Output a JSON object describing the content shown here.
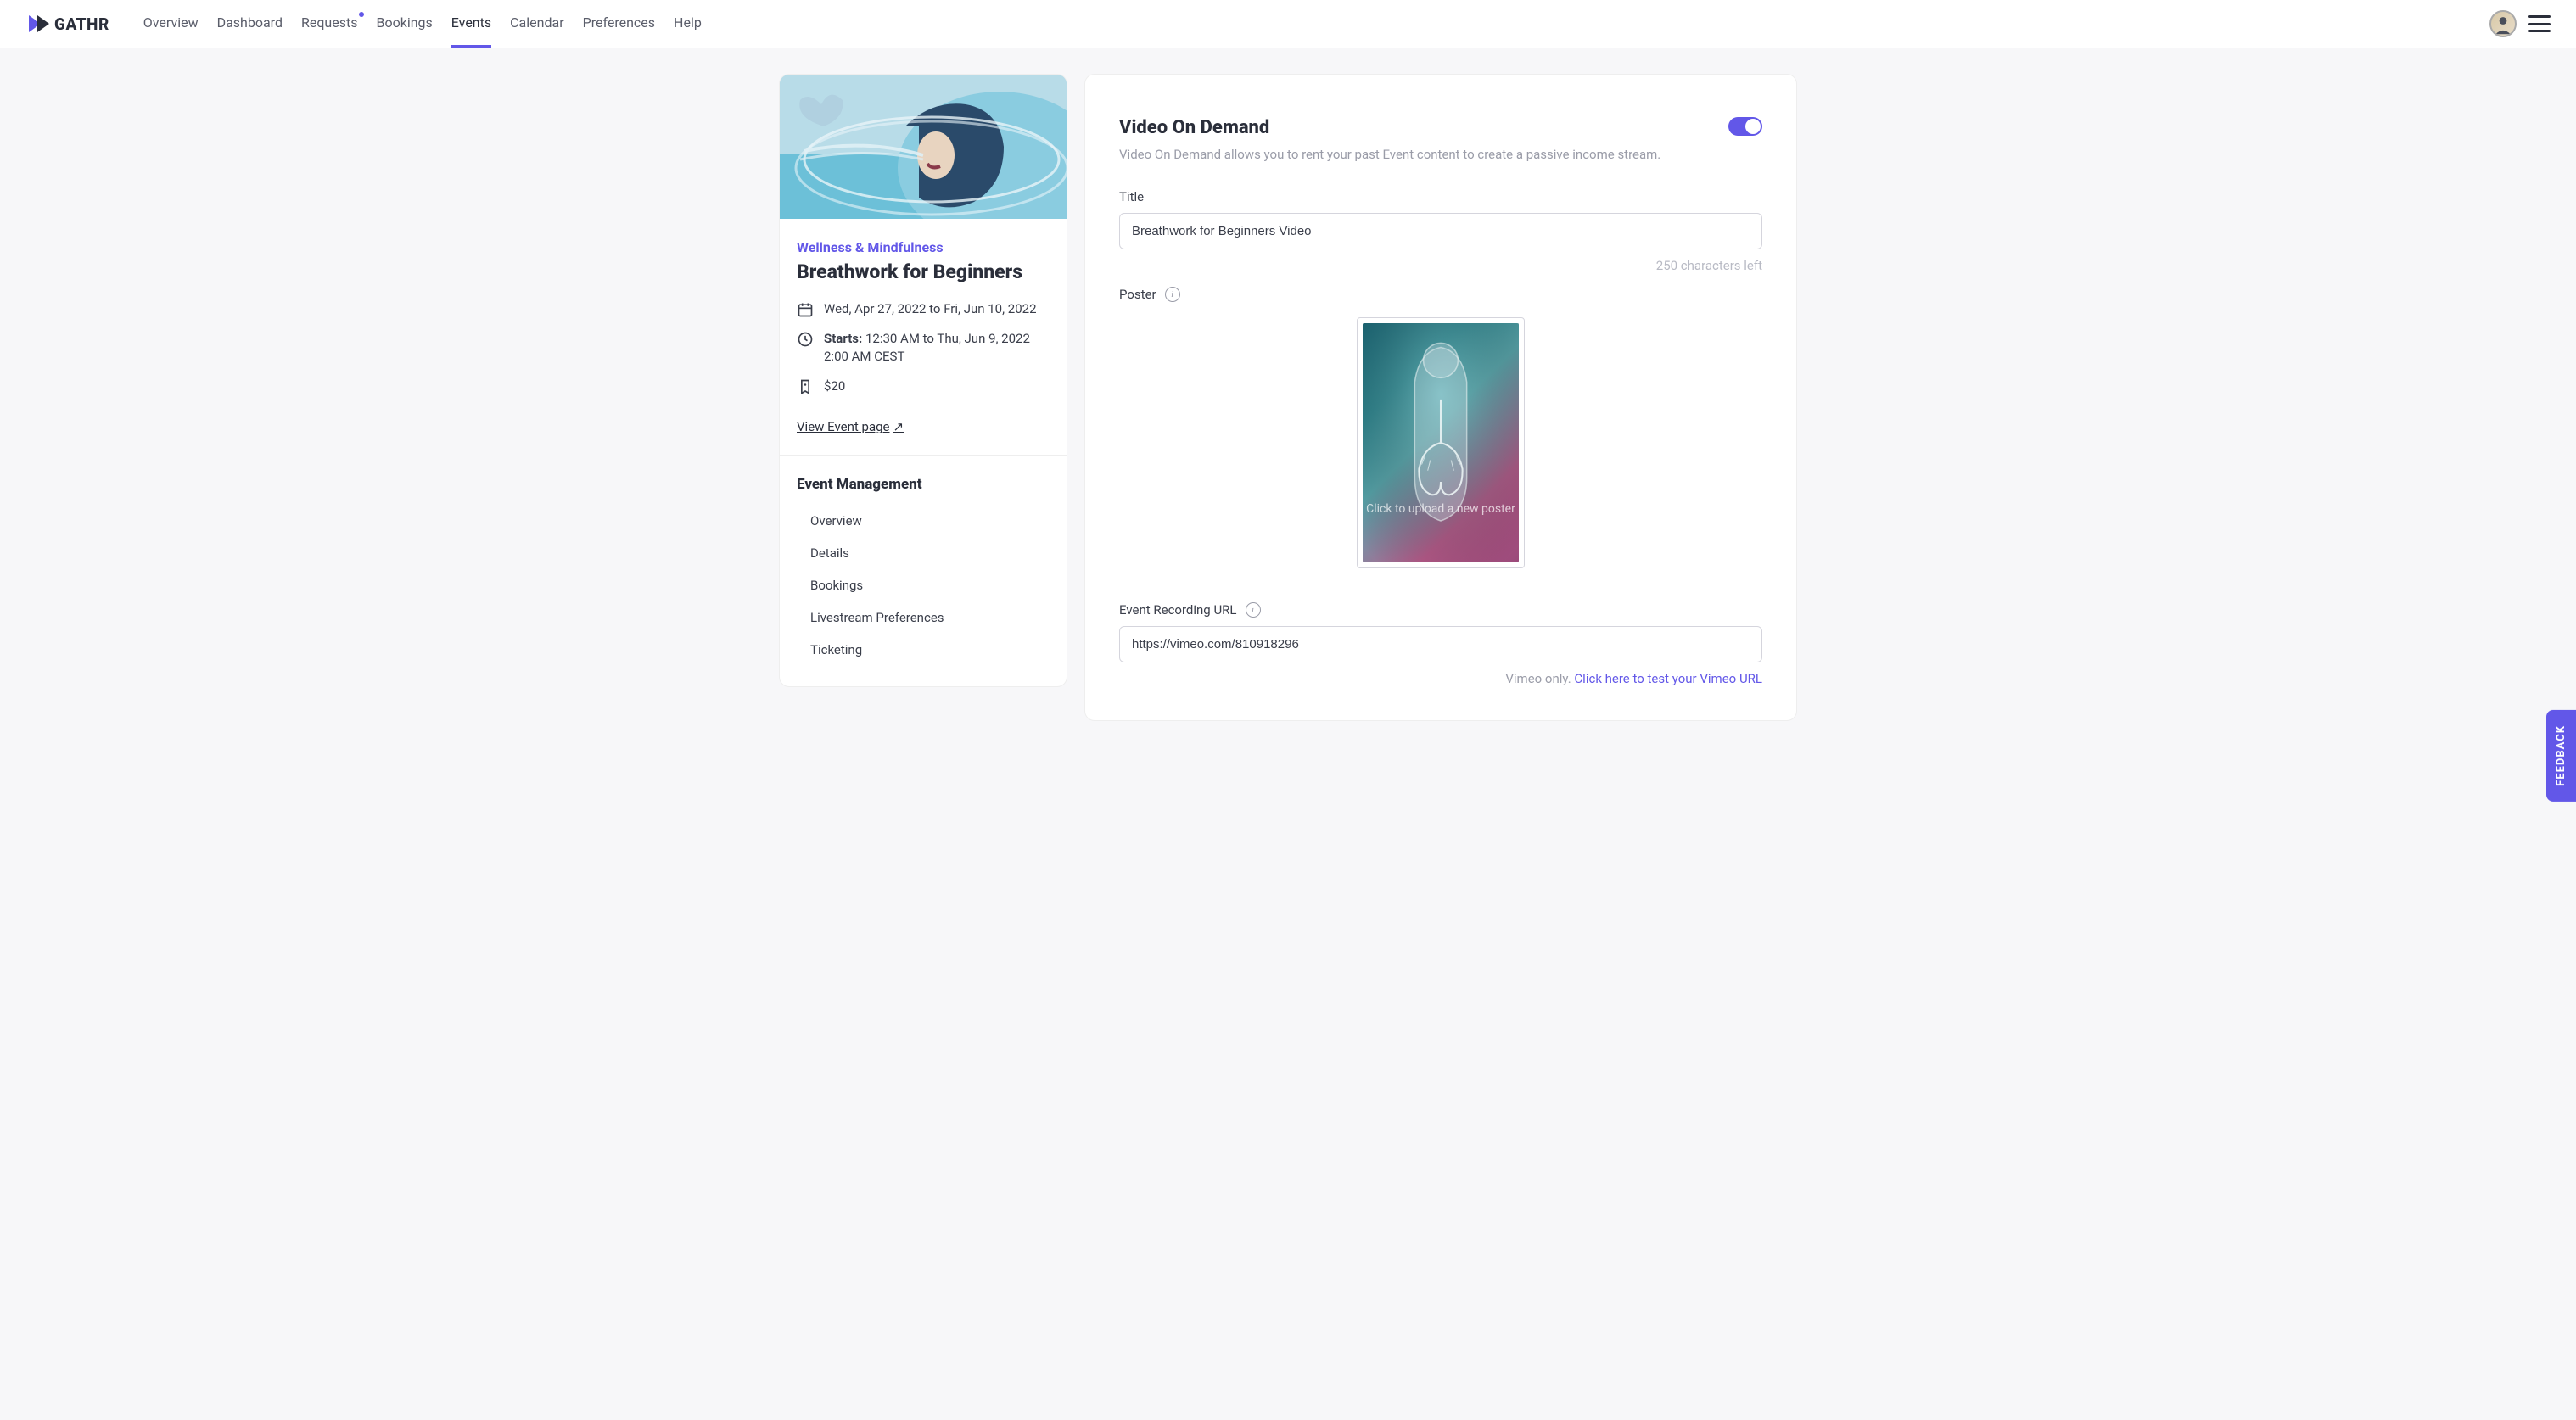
{
  "brand": {
    "name": "GATHR"
  },
  "nav": {
    "items": [
      {
        "label": "Overview",
        "active": false,
        "has_dot": false
      },
      {
        "label": "Dashboard",
        "active": false,
        "has_dot": false
      },
      {
        "label": "Requests",
        "active": false,
        "has_dot": true
      },
      {
        "label": "Bookings",
        "active": false,
        "has_dot": false
      },
      {
        "label": "Events",
        "active": true,
        "has_dot": false
      },
      {
        "label": "Calendar",
        "active": false,
        "has_dot": false
      },
      {
        "label": "Preferences",
        "active": false,
        "has_dot": false
      },
      {
        "label": "Help",
        "active": false,
        "has_dot": false
      }
    ]
  },
  "sidebar": {
    "category": "Wellness & Mindfulness",
    "title": "Breathwork for Beginners",
    "date_range": "Wed, Apr 27, 2022 to Fri, Jun 10, 2022",
    "starts_label": "Starts:",
    "starts_value": "12:30 AM to Thu, Jun 9, 2022 2:00 AM CEST",
    "price": "$20",
    "view_link": "View Event page",
    "management_title": "Event Management",
    "management_items": [
      "Overview",
      "Details",
      "Bookings",
      "Livestream Preferences",
      "Ticketing"
    ]
  },
  "main": {
    "section_title": "Video On Demand",
    "section_sub": "Video On Demand allows you to rent your past Event content to create a passive income stream.",
    "toggle_on": true,
    "title_label": "Title",
    "title_value": "Breathwork for Beginners Video",
    "chars_left": "250 characters left",
    "poster_label": "Poster",
    "poster_overlay_text": "Click to upload a new poster",
    "recording_label": "Event Recording URL",
    "recording_value": "https://vimeo.com/810918296",
    "vimeo_hint_prefix": "Vimeo only. ",
    "vimeo_hint_link": "Click here to test your Vimeo URL"
  },
  "feedback": "FEEDBACK"
}
